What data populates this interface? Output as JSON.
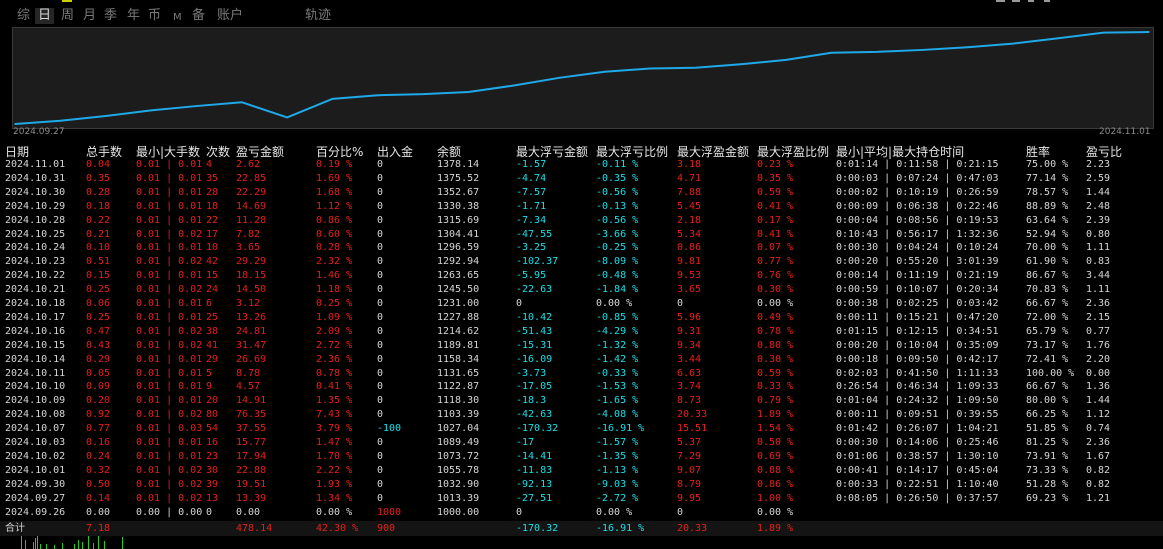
{
  "tabs": [
    {
      "label": "综",
      "active": false,
      "small": false
    },
    {
      "label": "日",
      "active": true,
      "small": false
    },
    {
      "label": "周",
      "active": false,
      "small": false
    },
    {
      "label": "月",
      "active": false,
      "small": false
    },
    {
      "label": "季",
      "active": false,
      "small": false
    },
    {
      "label": "年",
      "active": false,
      "small": false
    },
    {
      "label": "币",
      "active": false,
      "small": false
    },
    {
      "label": "M",
      "active": false,
      "small": true
    },
    {
      "label": "备",
      "active": false,
      "small": false
    },
    {
      "label": "账户",
      "active": false,
      "small": false
    },
    {
      "label": "轨迹",
      "active": false,
      "small": false
    }
  ],
  "colors": {
    "curve": "#1fa9e8",
    "text": "#d6d6d6",
    "negative_red": "#e5201a",
    "cyan": "#18e0e8",
    "panel": "#1c1c1c"
  },
  "chart_data": {
    "type": "line",
    "x": [
      "2024.09.26",
      "2024.09.27",
      "2024.09.30",
      "2024.10.01",
      "2024.10.02",
      "2024.10.03",
      "2024.10.07",
      "2024.10.08",
      "2024.10.09",
      "2024.10.10",
      "2024.10.11",
      "2024.10.14",
      "2024.10.15",
      "2024.10.16",
      "2024.10.17",
      "2024.10.18",
      "2024.10.21",
      "2024.10.22",
      "2024.10.23",
      "2024.10.24",
      "2024.10.25",
      "2024.10.28",
      "2024.10.29",
      "2024.10.30",
      "2024.10.31",
      "2024.11.01"
    ],
    "values": [
      1000.0,
      1013.39,
      1032.9,
      1055.78,
      1073.72,
      1089.49,
      1027.04,
      1103.39,
      1118.3,
      1122.87,
      1131.65,
      1158.34,
      1189.81,
      1214.62,
      1227.88,
      1231.0,
      1245.5,
      1263.65,
      1292.94,
      1296.59,
      1304.41,
      1315.69,
      1330.38,
      1352.67,
      1375.52,
      1378.14
    ],
    "x_start_label": "2024.09.27",
    "x_end_label": "2024.11.01"
  },
  "table": {
    "headers": [
      "日期",
      "总手数",
      "最小|大手数",
      "次数",
      "盈亏金额",
      "百分比%",
      "出入金",
      "余额",
      "最大浮亏金额",
      "最大浮亏比例",
      "最大浮盈金额",
      "最大浮盈比例",
      "最小|平均|最大持仓时间",
      "胜率",
      "盈亏比"
    ],
    "rows": [
      [
        "2024.11.01",
        "0.04",
        "0.01 | 0.01",
        "4",
        "2.62",
        "0.19 %",
        "0",
        "1378.14",
        "-1.57",
        "-0.11 %",
        "3.18",
        "0.23 %",
        "0:01:14 | 0:11:58 | 0:21:15",
        "75.00 %",
        "2.23"
      ],
      [
        "2024.10.31",
        "0.35",
        "0.01 | 0.01",
        "35",
        "22.85",
        "1.69 %",
        "0",
        "1375.52",
        "-4.74",
        "-0.35 %",
        "4.71",
        "0.35 %",
        "0:00:03 | 0:07:24 | 0:47:03",
        "77.14 %",
        "2.59"
      ],
      [
        "2024.10.30",
        "0.28",
        "0.01 | 0.01",
        "28",
        "22.29",
        "1.68 %",
        "0",
        "1352.67",
        "-7.57",
        "-0.56 %",
        "7.88",
        "0.59 %",
        "0:00:02 | 0:10:19 | 0:26:59",
        "78.57 %",
        "1.44"
      ],
      [
        "2024.10.29",
        "0.18",
        "0.01 | 0.01",
        "18",
        "14.69",
        "1.12 %",
        "0",
        "1330.38",
        "-1.71",
        "-0.13 %",
        "5.45",
        "0.41 %",
        "0:00:09 | 0:06:38 | 0:22:46",
        "88.89 %",
        "2.48"
      ],
      [
        "2024.10.28",
        "0.22",
        "0.01 | 0.01",
        "22",
        "11.28",
        "0.86 %",
        "0",
        "1315.69",
        "-7.34",
        "-0.56 %",
        "2.18",
        "0.17 %",
        "0:00:04 | 0:08:56 | 0:19:53",
        "63.64 %",
        "2.39"
      ],
      [
        "2024.10.25",
        "0.21",
        "0.01 | 0.02",
        "17",
        "7.82",
        "0.60 %",
        "0",
        "1304.41",
        "-47.55",
        "-3.66 %",
        "5.34",
        "0.41 %",
        "0:10:43 | 0:56:17 | 1:32:36",
        "52.94 %",
        "0.80"
      ],
      [
        "2024.10.24",
        "0.10",
        "0.01 | 0.01",
        "10",
        "3.65",
        "0.28 %",
        "0",
        "1296.59",
        "-3.25",
        "-0.25 %",
        "0.86",
        "0.07 %",
        "0:00:30 | 0:04:24 | 0:10:24",
        "70.00 %",
        "1.11"
      ],
      [
        "2024.10.23",
        "0.51",
        "0.01 | 0.02",
        "42",
        "29.29",
        "2.32 %",
        "0",
        "1292.94",
        "-102.37",
        "-8.09 %",
        "9.81",
        "0.77 %",
        "0:00:20 | 0:55:20 | 3:01:39",
        "61.90 %",
        "0.83"
      ],
      [
        "2024.10.22",
        "0.15",
        "0.01 | 0.01",
        "15",
        "18.15",
        "1.46 %",
        "0",
        "1263.65",
        "-5.95",
        "-0.48 %",
        "9.53",
        "0.76 %",
        "0:00:14 | 0:11:19 | 0:21:19",
        "86.67 %",
        "3.44"
      ],
      [
        "2024.10.21",
        "0.25",
        "0.01 | 0.02",
        "24",
        "14.50",
        "1.18 %",
        "0",
        "1245.50",
        "-22.63",
        "-1.84 %",
        "3.65",
        "0.30 %",
        "0:00:59 | 0:10:07 | 0:20:34",
        "70.83 %",
        "1.11"
      ],
      [
        "2024.10.18",
        "0.06",
        "0.01 | 0.01",
        "6",
        "3.12",
        "0.25 %",
        "0",
        "1231.00",
        "0",
        "0.00 %",
        "0",
        "0.00 %",
        "0:00:38 | 0:02:25 | 0:03:42",
        "66.67 %",
        "2.36"
      ],
      [
        "2024.10.17",
        "0.25",
        "0.01 | 0.01",
        "25",
        "13.26",
        "1.09 %",
        "0",
        "1227.88",
        "-10.42",
        "-0.85 %",
        "5.96",
        "0.49 %",
        "0:00:11 | 0:15:21 | 0:47:20",
        "72.00 %",
        "2.15"
      ],
      [
        "2024.10.16",
        "0.47",
        "0.01 | 0.02",
        "38",
        "24.81",
        "2.09 %",
        "0",
        "1214.62",
        "-51.43",
        "-4.29 %",
        "9.31",
        "0.78 %",
        "0:01:15 | 0:12:15 | 0:34:51",
        "65.79 %",
        "0.77"
      ],
      [
        "2024.10.15",
        "0.43",
        "0.01 | 0.02",
        "41",
        "31.47",
        "2.72 %",
        "0",
        "1189.81",
        "-15.31",
        "-1.32 %",
        "9.34",
        "0.80 %",
        "0:00:20 | 0:10:04 | 0:35:09",
        "73.17 %",
        "1.76"
      ],
      [
        "2024.10.14",
        "0.29",
        "0.01 | 0.01",
        "29",
        "26.69",
        "2.36 %",
        "0",
        "1158.34",
        "-16.09",
        "-1.42 %",
        "3.44",
        "0.30 %",
        "0:00:18 | 0:09:50 | 0:42:17",
        "72.41 %",
        "2.20"
      ],
      [
        "2024.10.11",
        "0.05",
        "0.01 | 0.01",
        "5",
        "8.78",
        "0.78 %",
        "0",
        "1131.65",
        "-3.73",
        "-0.33 %",
        "6.63",
        "0.59 %",
        "0:02:03 | 0:41:50 | 1:11:33",
        "100.00 %",
        "0.00"
      ],
      [
        "2024.10.10",
        "0.09",
        "0.01 | 0.01",
        "9",
        "4.57",
        "0.41 %",
        "0",
        "1122.87",
        "-17.05",
        "-1.53 %",
        "3.74",
        "0.33 %",
        "0:26:54 | 0:46:34 | 1:09:33",
        "66.67 %",
        "1.36"
      ],
      [
        "2024.10.09",
        "0.20",
        "0.01 | 0.01",
        "20",
        "14.91",
        "1.35 %",
        "0",
        "1118.30",
        "-18.3",
        "-1.65 %",
        "8.73",
        "0.79 %",
        "0:01:04 | 0:24:32 | 1:09:50",
        "80.00 %",
        "1.44"
      ],
      [
        "2024.10.08",
        "0.92",
        "0.01 | 0.02",
        "80",
        "76.35",
        "7.43 %",
        "0",
        "1103.39",
        "-42.63",
        "-4.08 %",
        "20.33",
        "1.89 %",
        "0:00:11 | 0:09:51 | 0:39:55",
        "66.25 %",
        "1.12"
      ],
      [
        "2024.10.07",
        "0.77",
        "0.01 | 0.03",
        "54",
        "37.55",
        "3.79 %",
        "-100",
        "1027.04",
        "-170.32",
        "-16.91 %",
        "15.51",
        "1.54 %",
        "0:01:42 | 0:26:07 | 1:04:21",
        "51.85 %",
        "0.74"
      ],
      [
        "2024.10.03",
        "0.16",
        "0.01 | 0.01",
        "16",
        "15.77",
        "1.47 %",
        "0",
        "1089.49",
        "-17",
        "-1.57 %",
        "5.37",
        "0.50 %",
        "0:00:30 | 0:14:06 | 0:25:46",
        "81.25 %",
        "2.36"
      ],
      [
        "2024.10.02",
        "0.24",
        "0.01 | 0.01",
        "23",
        "17.94",
        "1.70 %",
        "0",
        "1073.72",
        "-14.41",
        "-1.35 %",
        "7.29",
        "0.69 %",
        "0:01:06 | 0:38:57 | 1:30:10",
        "73.91 %",
        "1.67"
      ],
      [
        "2024.10.01",
        "0.32",
        "0.01 | 0.02",
        "30",
        "22.88",
        "2.22 %",
        "0",
        "1055.78",
        "-11.83",
        "-1.13 %",
        "9.07",
        "0.88 %",
        "0:00:41 | 0:14:17 | 0:45:04",
        "73.33 %",
        "0.82"
      ],
      [
        "2024.09.30",
        "0.50",
        "0.01 | 0.02",
        "39",
        "19.51",
        "1.93 %",
        "0",
        "1032.90",
        "-92.13",
        "-9.03 %",
        "8.79",
        "0.86 %",
        "0:00:33 | 0:22:51 | 1:10:40",
        "51.28 %",
        "0.82"
      ],
      [
        "2024.09.27",
        "0.14",
        "0.01 | 0.02",
        "13",
        "13.39",
        "1.34 %",
        "0",
        "1013.39",
        "-27.51",
        "-2.72 %",
        "9.95",
        "1.00 %",
        "0:08:05 | 0:26:50 | 0:37:57",
        "69.23 %",
        "1.21"
      ],
      [
        "2024.09.26",
        "0.00",
        "0.00 | 0.00",
        "0",
        "0.00",
        "0.00 %",
        "1000",
        "1000.00",
        "0",
        "0.00 %",
        "0",
        "0.00 %",
        "",
        "",
        ""
      ]
    ],
    "total": [
      "合计",
      "7.18",
      "",
      "",
      "478.14",
      "42.30 %",
      "900",
      "",
      "-170.32",
      "-16.91 %",
      "20.33",
      "1.89 %",
      "",
      "",
      ""
    ]
  }
}
